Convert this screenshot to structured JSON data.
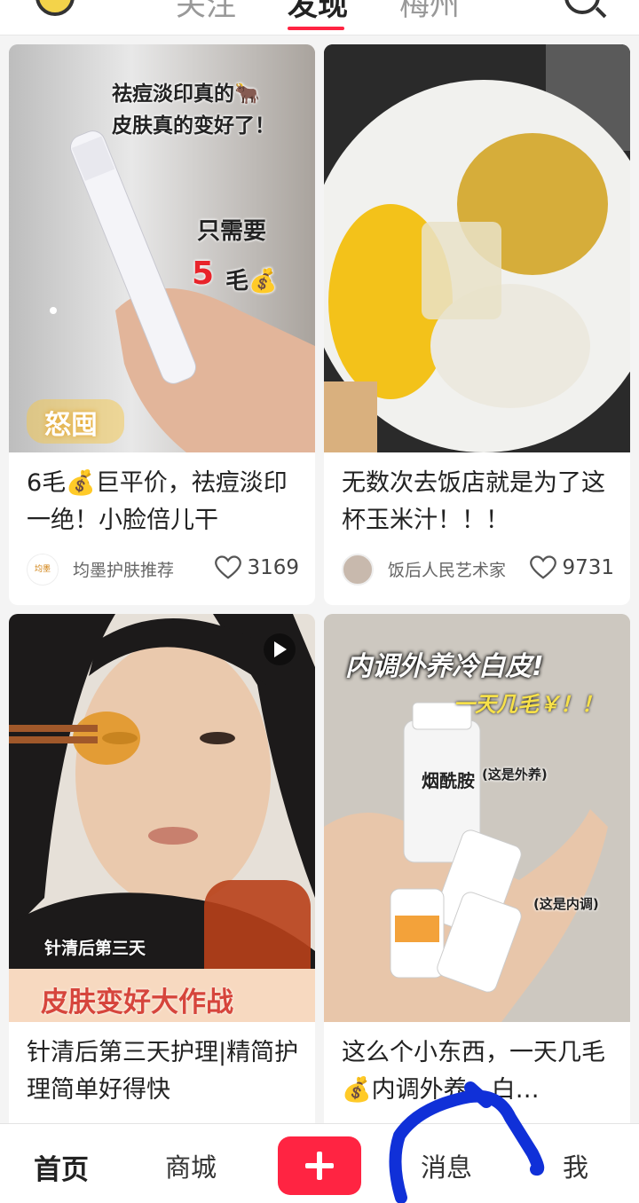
{
  "top_tabs": [
    "关注",
    "发现",
    "梅州"
  ],
  "cards": [
    {
      "overlay": [
        "祛痘淡印真的🐂",
        "皮肤真的变好了！",
        "只需要",
        "5",
        "毛💰",
        "怒囤"
      ],
      "title": "6毛💰巨平价，祛痘淡印一绝！小脸倍儿干",
      "author": "均墨护肤推荐",
      "author_badge": "均墨",
      "likes": "3169"
    },
    {
      "title": "无数次去饭店就是为了这杯玉米汁！！！",
      "author": "饭后人民艺术家",
      "likes": "9731"
    },
    {
      "overlay": [
        "针清后第三天",
        "皮肤变好大作战"
      ],
      "title": "针清后第三天护理|精简护理简单好得快"
    },
    {
      "overlay": [
        "内调外养冷白皮!",
        "一天几毛￥！！",
        "烟酰胺",
        "(这是外养)",
        "(这是内调)"
      ],
      "title": "这么个小东西，一天几毛💰内调外养，白…"
    }
  ],
  "bottom_nav": {
    "home": "首页",
    "mall": "商城",
    "messages": "消息",
    "me": "我"
  },
  "colors": {
    "brand_red": "#ff2442",
    "annotation_blue": "#1030d8"
  }
}
